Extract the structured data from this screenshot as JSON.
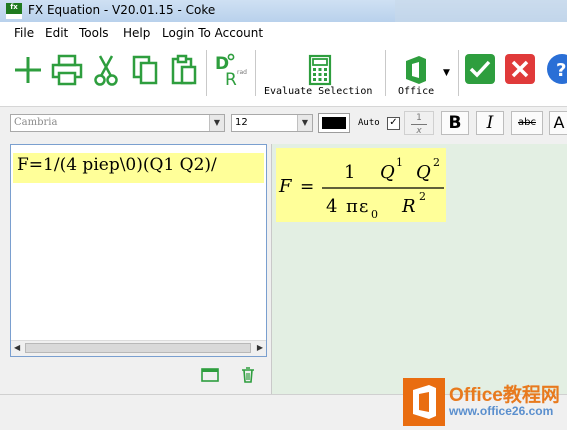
{
  "app": {
    "title": "FX Equation - V20.01.15 - Coke",
    "icon_text": "fx"
  },
  "menu": {
    "items": [
      "File",
      "Edit",
      "Tools",
      "Help",
      "Login To Account"
    ]
  },
  "toolbar": {
    "evaluate_label": "Evaluate Selection",
    "office_label": "Office",
    "deg_rad_label": "rad",
    "icons": [
      "add-icon",
      "print-icon",
      "cut-icon",
      "copy-icon",
      "paste-icon",
      "degree-radian-icon",
      "calculator-icon",
      "office-icon",
      "check-icon",
      "close-icon",
      "help-icon"
    ],
    "colors": {
      "green": "#2e9e3e",
      "red": "#e03a3a",
      "blue": "#2a6fd6"
    }
  },
  "format": {
    "font": "Cambria",
    "size": "12",
    "auto_label": "Auto",
    "auto_checked": true,
    "fraction_num": "1",
    "fraction_den": "x",
    "bold": "B",
    "italic": "I",
    "strike": "abc",
    "font_color": "#000000"
  },
  "editor": {
    "text": "F=1/(4 piep\\0)(Q1 Q2)/"
  },
  "equation": {
    "lhs": "F",
    "equals": "=",
    "num_coeff": "1",
    "q": "Q",
    "q1_sup": "1",
    "q2_sup": "2",
    "den_coeff": "4",
    "pi": "π",
    "epsilon": "ε",
    "epsilon_sub": "0",
    "r": "R",
    "r_sup": "2"
  },
  "watermark": {
    "title": "Office教程网",
    "url": "www.office26.com"
  }
}
